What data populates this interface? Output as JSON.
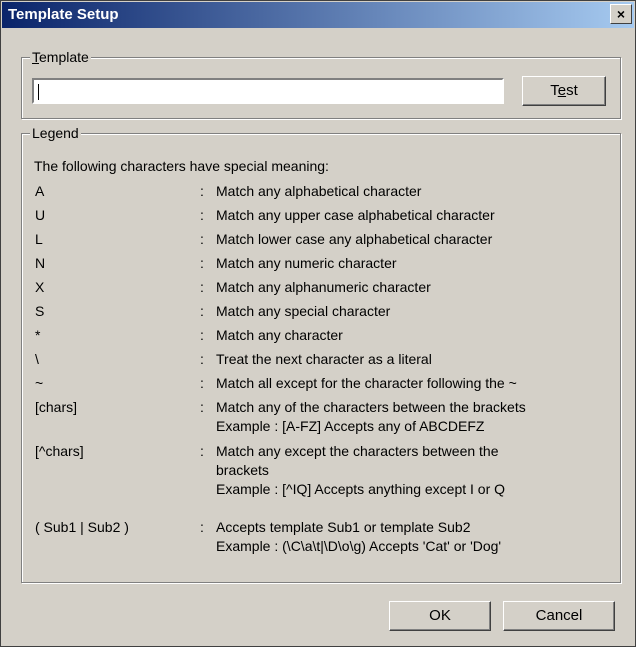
{
  "window": {
    "title": "Template Setup",
    "close_glyph": "×"
  },
  "template_group": {
    "label_mnemonic": "T",
    "label_rest": "emplate",
    "input_value": "",
    "test_button": {
      "pre": "T",
      "mnemonic": "e",
      "post": "st"
    }
  },
  "legend_group": {
    "label": "Legend",
    "intro": "The following characters have special meaning:",
    "rows": [
      {
        "key": "A",
        "sep": ":",
        "lines": [
          "Match any alphabetical character"
        ]
      },
      {
        "key": "U",
        "sep": ":",
        "lines": [
          "Match any upper case alphabetical character"
        ]
      },
      {
        "key": "L",
        "sep": ":",
        "lines": [
          "Match lower case any alphabetical character"
        ]
      },
      {
        "key": "N",
        "sep": ":",
        "lines": [
          "Match any numeric character"
        ]
      },
      {
        "key": "X",
        "sep": ":",
        "lines": [
          "Match any alphanumeric character"
        ]
      },
      {
        "key": "S",
        "sep": ":",
        "lines": [
          "Match any special character"
        ]
      },
      {
        "key": "*",
        "sep": ":",
        "lines": [
          "Match any character"
        ]
      },
      {
        "key": "\\",
        "sep": ":",
        "lines": [
          "Treat the next character as a literal"
        ]
      },
      {
        "key": "~",
        "sep": ":",
        "lines": [
          "Match all except for the character following the ~"
        ]
      },
      {
        "key": "[chars]",
        "sep": ":",
        "lines": [
          "Match any of the characters between the brackets",
          "Example : [A-FZ] Accepts any of ABCDEFZ"
        ]
      },
      {
        "key": "[^chars]",
        "sep": ":",
        "lines": [
          "Match any except the characters between the",
          "brackets",
          "Example : [^IQ] Accepts anything except I or Q"
        ]
      },
      {
        "key": "( Sub1 | Sub2 )",
        "sep": ":",
        "lines": [
          "Accepts template Sub1 or template Sub2",
          "Example : (\\C\\a\\t|\\D\\o\\g) Accepts 'Cat' or 'Dog'"
        ]
      }
    ]
  },
  "buttons": {
    "ok": "OK",
    "cancel": "Cancel"
  }
}
